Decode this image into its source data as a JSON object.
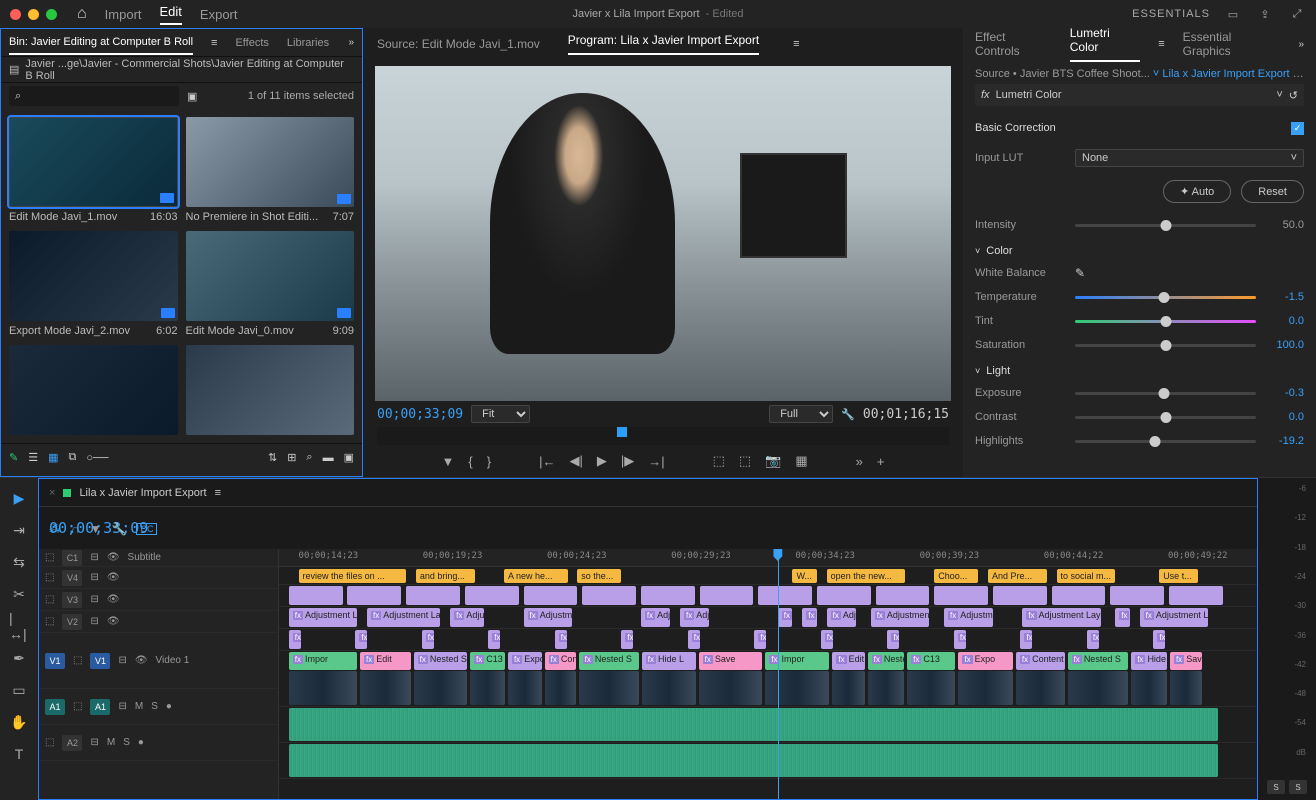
{
  "app": {
    "title": "Javier x Lila Import Export",
    "edited_suffix": "- Edited",
    "workspace": "ESSENTIALS",
    "modes": [
      "Import",
      "Edit",
      "Export"
    ],
    "active_mode": "Edit"
  },
  "project": {
    "tabs": [
      "Bin: Javier Editing at Computer B Roll",
      "Effects",
      "Libraries"
    ],
    "active_tab": 0,
    "breadcrumb": "Javier ...ge\\Javier - Commercial Shots\\Javier Editing at Computer B Roll",
    "search_placeholder": "",
    "selection_text": "1 of 11 items selected",
    "clips": [
      {
        "name": "Edit Mode Javi_1.mov",
        "dur": "16:03",
        "selected": true
      },
      {
        "name": "No Premiere in Shot Editi...",
        "dur": "7:07",
        "selected": false
      },
      {
        "name": "Export Mode Javi_2.mov",
        "dur": "6:02",
        "selected": false
      },
      {
        "name": "Edit Mode Javi_0.mov",
        "dur": "9:09",
        "selected": false
      }
    ]
  },
  "monitor": {
    "source_tab": "Source: Edit Mode Javi_1.mov",
    "program_tab": "Program: Lila x Javier Import Export",
    "active": "program",
    "current_tc": "00;00;33;09",
    "duration_tc": "00;01;16;15",
    "fit_label": "Fit",
    "full_label": "Full"
  },
  "lumetri": {
    "tabs": [
      "Effect Controls",
      "Lumetri Color",
      "Essential Graphics"
    ],
    "active_tab": 1,
    "source_line_prefix": "Source • Javier BTS Coffee Shoot...",
    "source_line_seq": "Lila x Javier Import Export • Jav...",
    "effect_name": "Lumetri Color",
    "section": "Basic Correction",
    "input_lut_label": "Input LUT",
    "input_lut_value": "None",
    "auto_label": "Auto",
    "reset_label": "Reset",
    "intensity_label": "Intensity",
    "intensity_value": "50.0",
    "color_group": "Color",
    "wb_label": "White Balance",
    "light_group": "Light",
    "params": {
      "temperature": {
        "label": "Temperature",
        "value": "-1.5",
        "pos": 49
      },
      "tint": {
        "label": "Tint",
        "value": "0.0",
        "pos": 50
      },
      "saturation": {
        "label": "Saturation",
        "value": "100.0",
        "pos": 50
      },
      "exposure": {
        "label": "Exposure",
        "value": "-0.3",
        "pos": 49
      },
      "contrast": {
        "label": "Contrast",
        "value": "0.0",
        "pos": 50
      },
      "highlights": {
        "label": "Highlights",
        "value": "-19.2",
        "pos": 44
      }
    }
  },
  "timeline": {
    "sequence_name": "Lila x Javier Import Export",
    "current_tc": "00;00;33;09",
    "ruler_ticks": [
      "00;00;14;23",
      "00;00;19;23",
      "00;00;24;23",
      "00;00;29;23",
      "00;00;34;23",
      "00;00;39;23",
      "00;00;44;22",
      "00;00;49;22"
    ],
    "playhead_pct": 51,
    "tracks": {
      "c1": {
        "label": "C1",
        "name": "Subtitle"
      },
      "v4": {
        "label": "V4"
      },
      "v3": {
        "label": "V3"
      },
      "v2": {
        "label": "V2"
      },
      "v1": {
        "label": "V1",
        "name": "Video 1"
      },
      "a1": {
        "label": "A1"
      },
      "a2": {
        "label": "A2"
      }
    },
    "subtitles": [
      {
        "l": 2,
        "w": 11,
        "t": "review the files on ..."
      },
      {
        "l": 14,
        "w": 6,
        "t": "and bring..."
      },
      {
        "l": 23,
        "w": 6.5,
        "t": "A new he..."
      },
      {
        "l": 30.5,
        "w": 4.5,
        "t": "so the..."
      },
      {
        "l": 52.5,
        "w": 2.5,
        "t": "W..."
      },
      {
        "l": 56,
        "w": 8,
        "t": "open the new..."
      },
      {
        "l": 67,
        "w": 4.5,
        "t": "Choo..."
      },
      {
        "l": 72.5,
        "w": 6,
        "t": "And Pre..."
      },
      {
        "l": 79.5,
        "w": 6,
        "t": "to social m..."
      },
      {
        "l": 90,
        "w": 4,
        "t": "Use t..."
      }
    ],
    "v3_clips": [
      {
        "l": 1,
        "w": 7,
        "t": "Adjustment La"
      },
      {
        "l": 9,
        "w": 7.5,
        "t": "Adjustment Lay"
      },
      {
        "l": 17.5,
        "w": 3.5,
        "t": "Adjus"
      },
      {
        "l": 25,
        "w": 5,
        "t": "Adjustm"
      },
      {
        "l": 37,
        "w": 3,
        "t": "Adjust"
      },
      {
        "l": 41,
        "w": 3,
        "t": "Adj"
      },
      {
        "l": 51,
        "w": 1.5,
        "t": "A"
      },
      {
        "l": 53.5,
        "w": 1.5,
        "t": "A"
      },
      {
        "l": 56,
        "w": 3,
        "t": "Adju"
      },
      {
        "l": 60.5,
        "w": 6,
        "t": "Adjustment L"
      },
      {
        "l": 68,
        "w": 5,
        "t": "Adjustme"
      },
      {
        "l": 76,
        "w": 8,
        "t": "Adjustment Layer"
      },
      {
        "l": 85.5,
        "w": 1.5,
        "t": "A"
      },
      {
        "l": 88,
        "w": 7,
        "t": "Adjustment L"
      }
    ],
    "v1_labels": [
      "Impor",
      "Edit",
      "Nested S",
      "C13",
      "Expo",
      "Content",
      "Nested S",
      "Hide L",
      "Save"
    ]
  },
  "audio_meter": {
    "ticks": [
      "-6",
      "-12",
      "-18",
      "-24",
      "-30",
      "-36",
      "-42",
      "-48",
      "-54",
      "dB"
    ],
    "solo_label": "S",
    "solo2_label": "S"
  }
}
